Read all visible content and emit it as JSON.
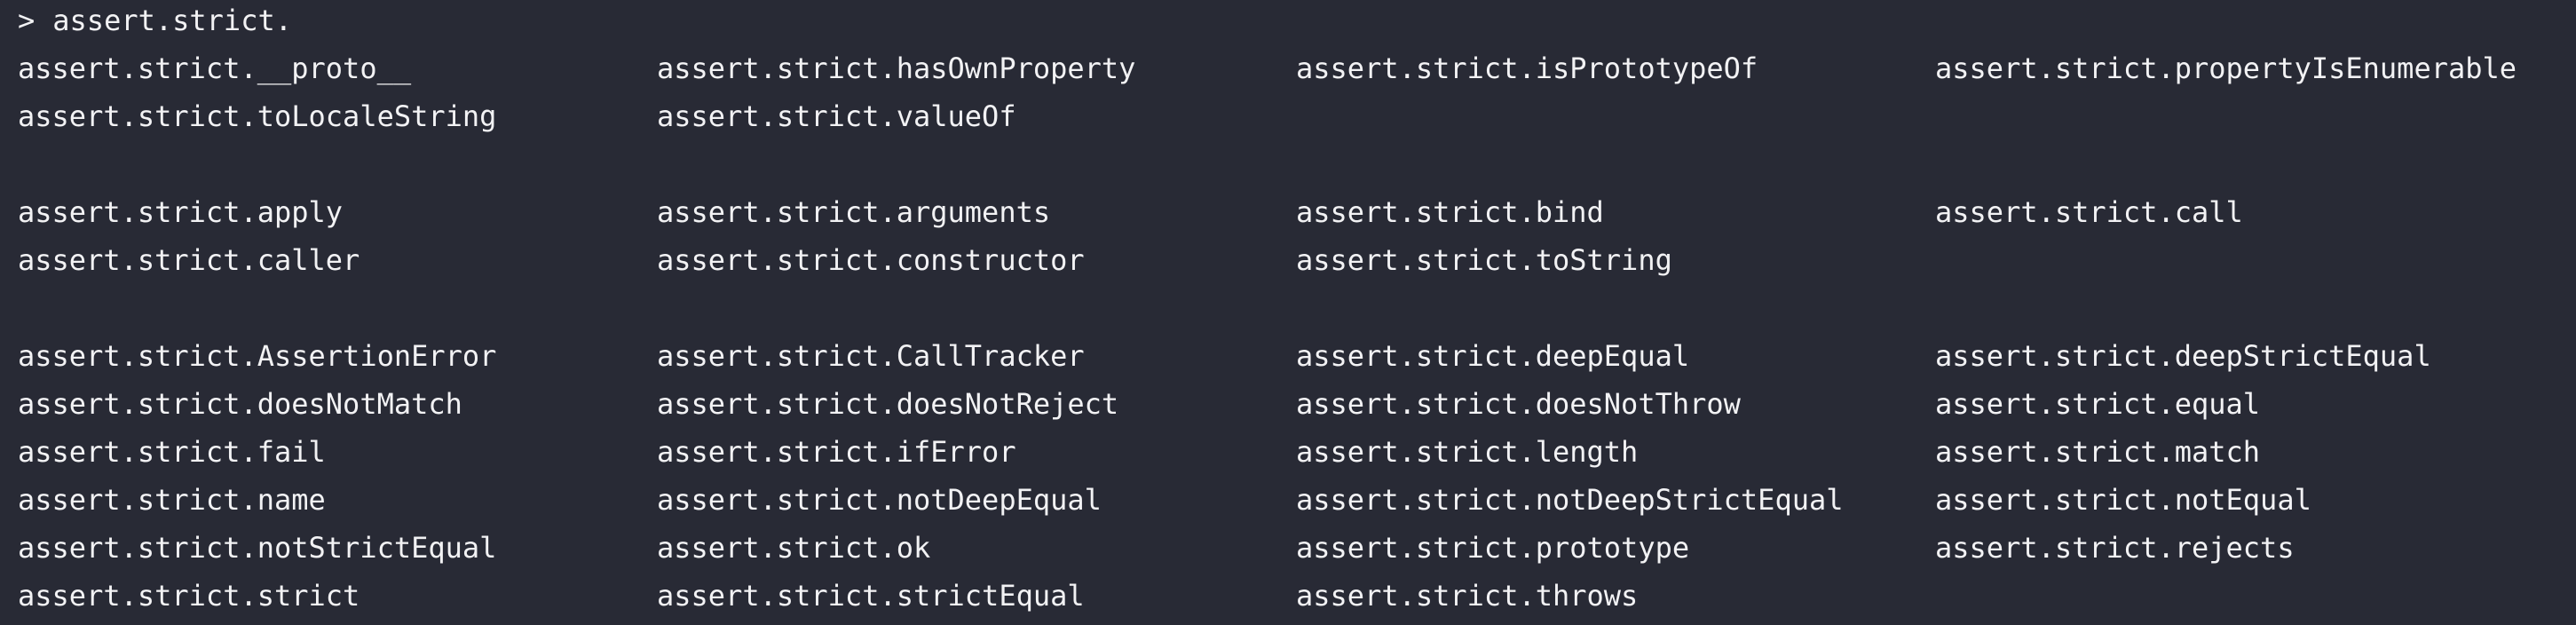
{
  "prompt": {
    "symbol": ">",
    "input": "assert.strict."
  },
  "completions": {
    "group1": [
      [
        "assert.strict.__proto__",
        "assert.strict.hasOwnProperty",
        "assert.strict.isPrototypeOf",
        "assert.strict.propertyIsEnumerable"
      ],
      [
        "assert.strict.toLocaleString",
        "assert.strict.valueOf"
      ]
    ],
    "group2": [
      [
        "assert.strict.apply",
        "assert.strict.arguments",
        "assert.strict.bind",
        "assert.strict.call"
      ],
      [
        "assert.strict.caller",
        "assert.strict.constructor",
        "assert.strict.toString"
      ]
    ],
    "group3": [
      [
        "assert.strict.AssertionError",
        "assert.strict.CallTracker",
        "assert.strict.deepEqual",
        "assert.strict.deepStrictEqual"
      ],
      [
        "assert.strict.doesNotMatch",
        "assert.strict.doesNotReject",
        "assert.strict.doesNotThrow",
        "assert.strict.equal"
      ],
      [
        "assert.strict.fail",
        "assert.strict.ifError",
        "assert.strict.length",
        "assert.strict.match"
      ],
      [
        "assert.strict.name",
        "assert.strict.notDeepEqual",
        "assert.strict.notDeepStrictEqual",
        "assert.strict.notEqual"
      ],
      [
        "assert.strict.notStrictEqual",
        "assert.strict.ok",
        "assert.strict.prototype",
        "assert.strict.rejects"
      ],
      [
        "assert.strict.strict",
        "assert.strict.strictEqual",
        "assert.strict.throws"
      ]
    ]
  },
  "colors": {
    "background": "#282a35",
    "text": "#f2f2f4"
  }
}
